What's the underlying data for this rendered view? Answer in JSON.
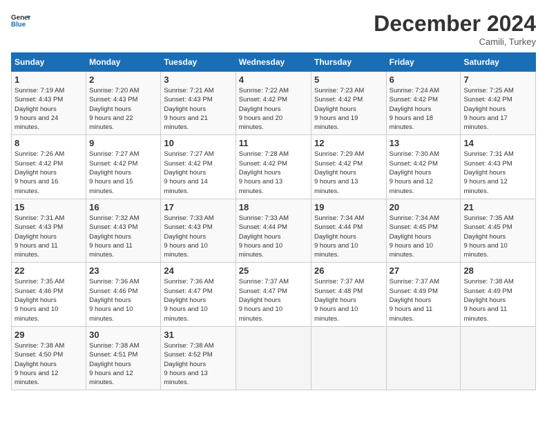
{
  "header": {
    "logo_line1": "General",
    "logo_line2": "Blue",
    "month": "December 2024",
    "location": "Camili, Turkey"
  },
  "days_of_week": [
    "Sunday",
    "Monday",
    "Tuesday",
    "Wednesday",
    "Thursday",
    "Friday",
    "Saturday"
  ],
  "weeks": [
    [
      {
        "day": "1",
        "sunrise": "7:19 AM",
        "sunset": "4:43 PM",
        "daylight": "9 hours and 24 minutes."
      },
      {
        "day": "2",
        "sunrise": "7:20 AM",
        "sunset": "4:43 PM",
        "daylight": "9 hours and 22 minutes."
      },
      {
        "day": "3",
        "sunrise": "7:21 AM",
        "sunset": "4:43 PM",
        "daylight": "9 hours and 21 minutes."
      },
      {
        "day": "4",
        "sunrise": "7:22 AM",
        "sunset": "4:42 PM",
        "daylight": "9 hours and 20 minutes."
      },
      {
        "day": "5",
        "sunrise": "7:23 AM",
        "sunset": "4:42 PM",
        "daylight": "9 hours and 19 minutes."
      },
      {
        "day": "6",
        "sunrise": "7:24 AM",
        "sunset": "4:42 PM",
        "daylight": "9 hours and 18 minutes."
      },
      {
        "day": "7",
        "sunrise": "7:25 AM",
        "sunset": "4:42 PM",
        "daylight": "9 hours and 17 minutes."
      }
    ],
    [
      {
        "day": "8",
        "sunrise": "7:26 AM",
        "sunset": "4:42 PM",
        "daylight": "9 hours and 16 minutes."
      },
      {
        "day": "9",
        "sunrise": "7:27 AM",
        "sunset": "4:42 PM",
        "daylight": "9 hours and 15 minutes."
      },
      {
        "day": "10",
        "sunrise": "7:27 AM",
        "sunset": "4:42 PM",
        "daylight": "9 hours and 14 minutes."
      },
      {
        "day": "11",
        "sunrise": "7:28 AM",
        "sunset": "4:42 PM",
        "daylight": "9 hours and 13 minutes."
      },
      {
        "day": "12",
        "sunrise": "7:29 AM",
        "sunset": "4:42 PM",
        "daylight": "9 hours and 13 minutes."
      },
      {
        "day": "13",
        "sunrise": "7:30 AM",
        "sunset": "4:42 PM",
        "daylight": "9 hours and 12 minutes."
      },
      {
        "day": "14",
        "sunrise": "7:31 AM",
        "sunset": "4:43 PM",
        "daylight": "9 hours and 12 minutes."
      }
    ],
    [
      {
        "day": "15",
        "sunrise": "7:31 AM",
        "sunset": "4:43 PM",
        "daylight": "9 hours and 11 minutes."
      },
      {
        "day": "16",
        "sunrise": "7:32 AM",
        "sunset": "4:43 PM",
        "daylight": "9 hours and 11 minutes."
      },
      {
        "day": "17",
        "sunrise": "7:33 AM",
        "sunset": "4:43 PM",
        "daylight": "9 hours and 10 minutes."
      },
      {
        "day": "18",
        "sunrise": "7:33 AM",
        "sunset": "4:44 PM",
        "daylight": "9 hours and 10 minutes."
      },
      {
        "day": "19",
        "sunrise": "7:34 AM",
        "sunset": "4:44 PM",
        "daylight": "9 hours and 10 minutes."
      },
      {
        "day": "20",
        "sunrise": "7:34 AM",
        "sunset": "4:45 PM",
        "daylight": "9 hours and 10 minutes."
      },
      {
        "day": "21",
        "sunrise": "7:35 AM",
        "sunset": "4:45 PM",
        "daylight": "9 hours and 10 minutes."
      }
    ],
    [
      {
        "day": "22",
        "sunrise": "7:35 AM",
        "sunset": "4:46 PM",
        "daylight": "9 hours and 10 minutes."
      },
      {
        "day": "23",
        "sunrise": "7:36 AM",
        "sunset": "4:46 PM",
        "daylight": "9 hours and 10 minutes."
      },
      {
        "day": "24",
        "sunrise": "7:36 AM",
        "sunset": "4:47 PM",
        "daylight": "9 hours and 10 minutes."
      },
      {
        "day": "25",
        "sunrise": "7:37 AM",
        "sunset": "4:47 PM",
        "daylight": "9 hours and 10 minutes."
      },
      {
        "day": "26",
        "sunrise": "7:37 AM",
        "sunset": "4:48 PM",
        "daylight": "9 hours and 10 minutes."
      },
      {
        "day": "27",
        "sunrise": "7:37 AM",
        "sunset": "4:49 PM",
        "daylight": "9 hours and 11 minutes."
      },
      {
        "day": "28",
        "sunrise": "7:38 AM",
        "sunset": "4:49 PM",
        "daylight": "9 hours and 11 minutes."
      }
    ],
    [
      {
        "day": "29",
        "sunrise": "7:38 AM",
        "sunset": "4:50 PM",
        "daylight": "9 hours and 12 minutes."
      },
      {
        "day": "30",
        "sunrise": "7:38 AM",
        "sunset": "4:51 PM",
        "daylight": "9 hours and 12 minutes."
      },
      {
        "day": "31",
        "sunrise": "7:38 AM",
        "sunset": "4:52 PM",
        "daylight": "9 hours and 13 minutes."
      },
      null,
      null,
      null,
      null
    ]
  ]
}
